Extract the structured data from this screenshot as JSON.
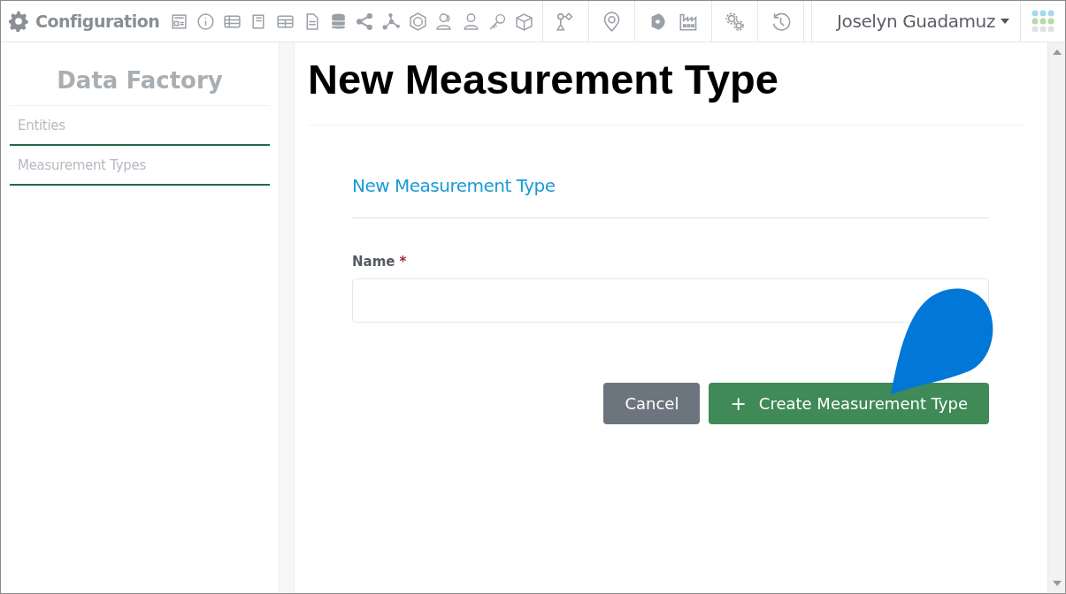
{
  "header": {
    "title": "Configuration",
    "user": "Joselyn Guadamuz"
  },
  "sidebar": {
    "title": "Data Factory",
    "items": [
      {
        "label": "Entities"
      },
      {
        "label": "Measurement Types"
      }
    ]
  },
  "page": {
    "title": "New Measurement Type"
  },
  "form": {
    "title": "New Measurement Type",
    "fields": [
      {
        "label": "Name",
        "required": true,
        "required_mark": "*"
      }
    ],
    "buttons": [
      {
        "kind": "secondary",
        "label": "Cancel"
      },
      {
        "kind": "primary",
        "icon": "+",
        "label": "Create Measurement Type"
      }
    ]
  }
}
